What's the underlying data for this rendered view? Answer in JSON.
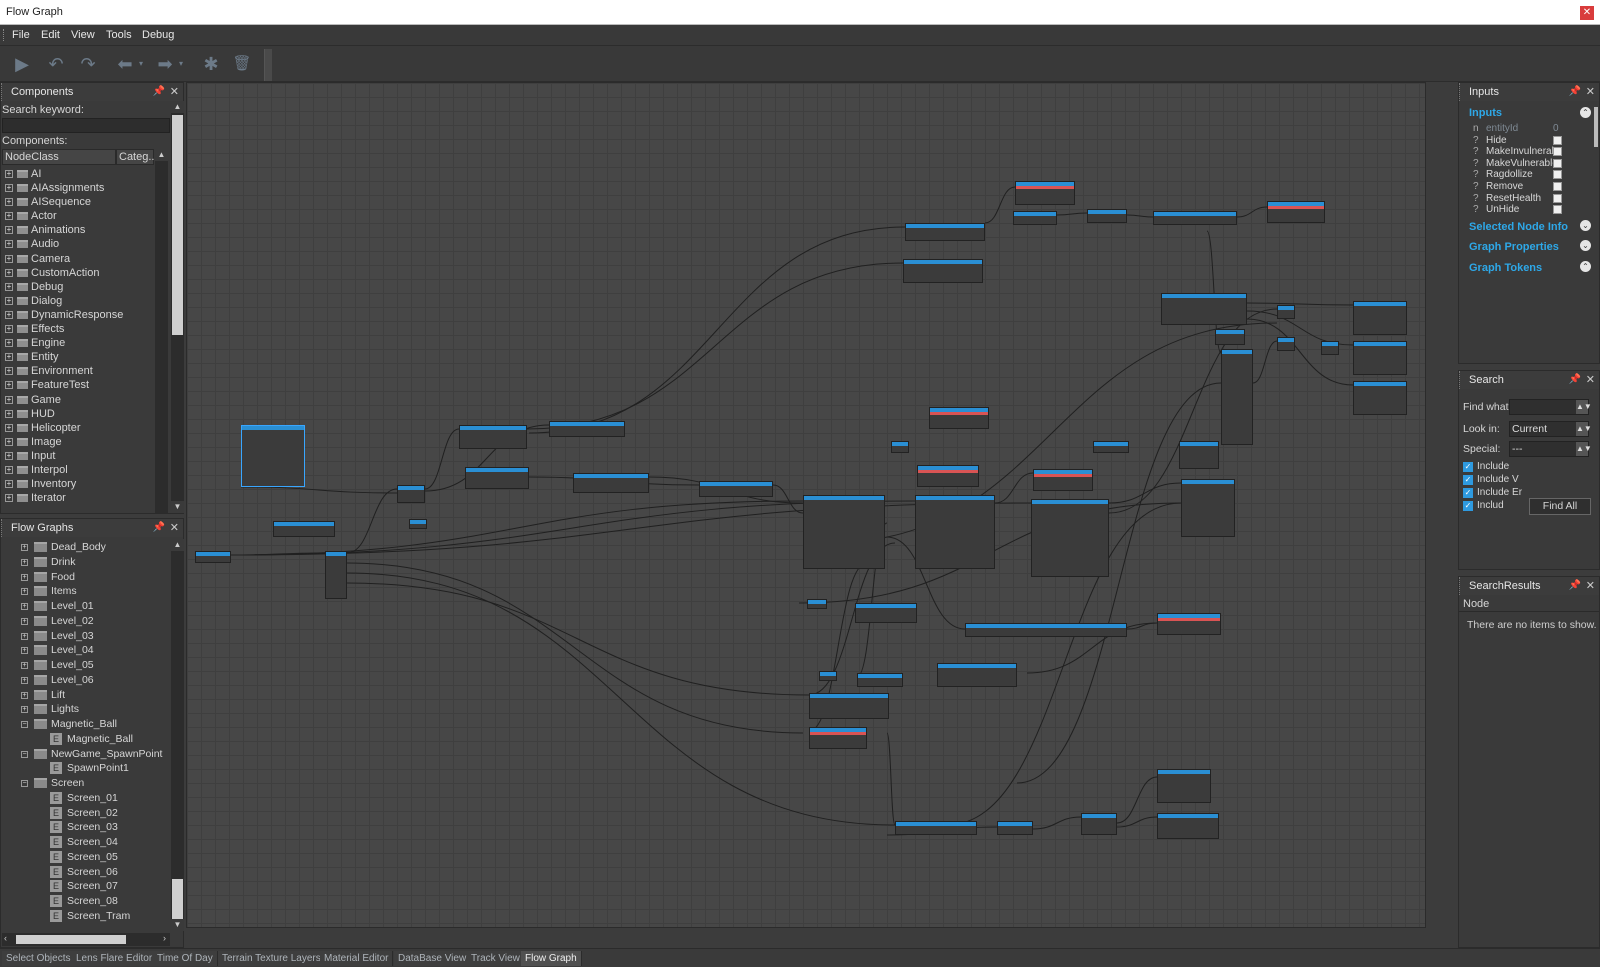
{
  "window": {
    "title": "Flow Graph"
  },
  "menu": [
    "File",
    "Edit",
    "View",
    "Tools",
    "Debug"
  ],
  "toolbar": {
    "buttons": [
      {
        "name": "play-icon",
        "glyph": "▶"
      },
      {
        "name": "undo-icon",
        "glyph": "↶"
      },
      {
        "name": "redo-icon",
        "glyph": "↷"
      },
      {
        "name": "back-arrow-icon",
        "glyph": "⬅"
      },
      {
        "name": "forward-arrow-icon",
        "glyph": "➡"
      },
      {
        "name": "debug-bug-icon",
        "glyph": "✱"
      },
      {
        "name": "trash-icon",
        "glyph": "🗑"
      }
    ]
  },
  "components": {
    "title": "Components",
    "search_label": "Search keyword:",
    "search_value": "",
    "list_label": "Components:",
    "col_nodeclass": "NodeClass",
    "col_category": "Categ...",
    "items": [
      "AI",
      "AIAssignments",
      "AISequence",
      "Actor",
      "Animations",
      "Audio",
      "Camera",
      "CustomAction",
      "Debug",
      "Dialog",
      "DynamicResponse",
      "Effects",
      "Engine",
      "Entity",
      "Environment",
      "FeatureTest",
      "Game",
      "HUD",
      "Helicopter",
      "Image",
      "Input",
      "Interpol",
      "Inventory",
      "Iterator"
    ]
  },
  "flowgraphs": {
    "title": "Flow Graphs",
    "items": [
      {
        "label": "Dead_Body",
        "type": "folder",
        "level": 1,
        "exp": "+"
      },
      {
        "label": "Drink",
        "type": "folder",
        "level": 1,
        "exp": "+"
      },
      {
        "label": "Food",
        "type": "folder",
        "level": 1,
        "exp": "+"
      },
      {
        "label": "Items",
        "type": "folder",
        "level": 1,
        "exp": "+"
      },
      {
        "label": "Level_01",
        "type": "folder",
        "level": 1,
        "exp": "+"
      },
      {
        "label": "Level_02",
        "type": "folder",
        "level": 1,
        "exp": "+"
      },
      {
        "label": "Level_03",
        "type": "folder",
        "level": 1,
        "exp": "+"
      },
      {
        "label": "Level_04",
        "type": "folder",
        "level": 1,
        "exp": "+"
      },
      {
        "label": "Level_05",
        "type": "folder",
        "level": 1,
        "exp": "+"
      },
      {
        "label": "Level_06",
        "type": "folder",
        "level": 1,
        "exp": "+"
      },
      {
        "label": "Lift",
        "type": "folder",
        "level": 1,
        "exp": "+"
      },
      {
        "label": "Lights",
        "type": "folder",
        "level": 1,
        "exp": "+"
      },
      {
        "label": "Magnetic_Ball",
        "type": "folder",
        "level": 1,
        "exp": "-"
      },
      {
        "label": "Magnetic_Ball",
        "type": "entity",
        "level": 2,
        "exp": ""
      },
      {
        "label": "NewGame_SpawnPoint",
        "type": "folder",
        "level": 1,
        "exp": "-"
      },
      {
        "label": "SpawnPoint1",
        "type": "entity",
        "level": 2,
        "exp": ""
      },
      {
        "label": "Screen",
        "type": "folder",
        "level": 1,
        "exp": "-"
      },
      {
        "label": "Screen_01",
        "type": "entity",
        "level": 2,
        "exp": ""
      },
      {
        "label": "Screen_02",
        "type": "entity",
        "level": 2,
        "exp": ""
      },
      {
        "label": "Screen_03",
        "type": "entity",
        "level": 2,
        "exp": ""
      },
      {
        "label": "Screen_04",
        "type": "entity",
        "level": 2,
        "exp": ""
      },
      {
        "label": "Screen_05",
        "type": "entity",
        "level": 2,
        "exp": ""
      },
      {
        "label": "Screen_06",
        "type": "entity",
        "level": 2,
        "exp": ""
      },
      {
        "label": "Screen_07",
        "type": "entity",
        "level": 2,
        "exp": ""
      },
      {
        "label": "Screen_08",
        "type": "entity",
        "level": 2,
        "exp": ""
      },
      {
        "label": "Screen_Tram",
        "type": "entity",
        "level": 2,
        "exp": ""
      }
    ]
  },
  "inputs": {
    "title": "Inputs",
    "section_inputs": "Inputs",
    "params": [
      {
        "q": "n",
        "name": "entityId",
        "value": "0",
        "dim": true
      },
      {
        "q": "?",
        "name": "Hide"
      },
      {
        "q": "?",
        "name": "MakeInvulnerab"
      },
      {
        "q": "?",
        "name": "MakeVulnerable"
      },
      {
        "q": "?",
        "name": "Ragdollize"
      },
      {
        "q": "?",
        "name": "Remove"
      },
      {
        "q": "?",
        "name": "ResetHealth"
      },
      {
        "q": "?",
        "name": "UnHide"
      }
    ],
    "section_node_info": "Selected Node Info",
    "section_graph_props": "Graph Properties",
    "section_graph_tokens": "Graph Tokens"
  },
  "search": {
    "title": "Search",
    "find_label": "Find what:",
    "find_value": "",
    "lookin_label": "Look in:",
    "lookin_value": "Current",
    "special_label": "Special:",
    "special_value": "---",
    "checks": [
      "Include",
      "Include V",
      "Include Er",
      "Includ"
    ],
    "find_all": "Find All"
  },
  "results": {
    "title": "SearchResults",
    "col_node": "Node",
    "empty": "There are no items to show."
  },
  "tabs": {
    "items": [
      "Select Objects",
      "Lens Flare Editor",
      "Time Of Day",
      "Terrain Texture Layers",
      "Material Editor",
      "DataBase View",
      "Track View",
      "Flow Graph"
    ],
    "active": "Flow Graph"
  },
  "colors": {
    "accent": "#2ea8e8",
    "node_header": "#2a8fd4",
    "node_red": "#d95454"
  }
}
